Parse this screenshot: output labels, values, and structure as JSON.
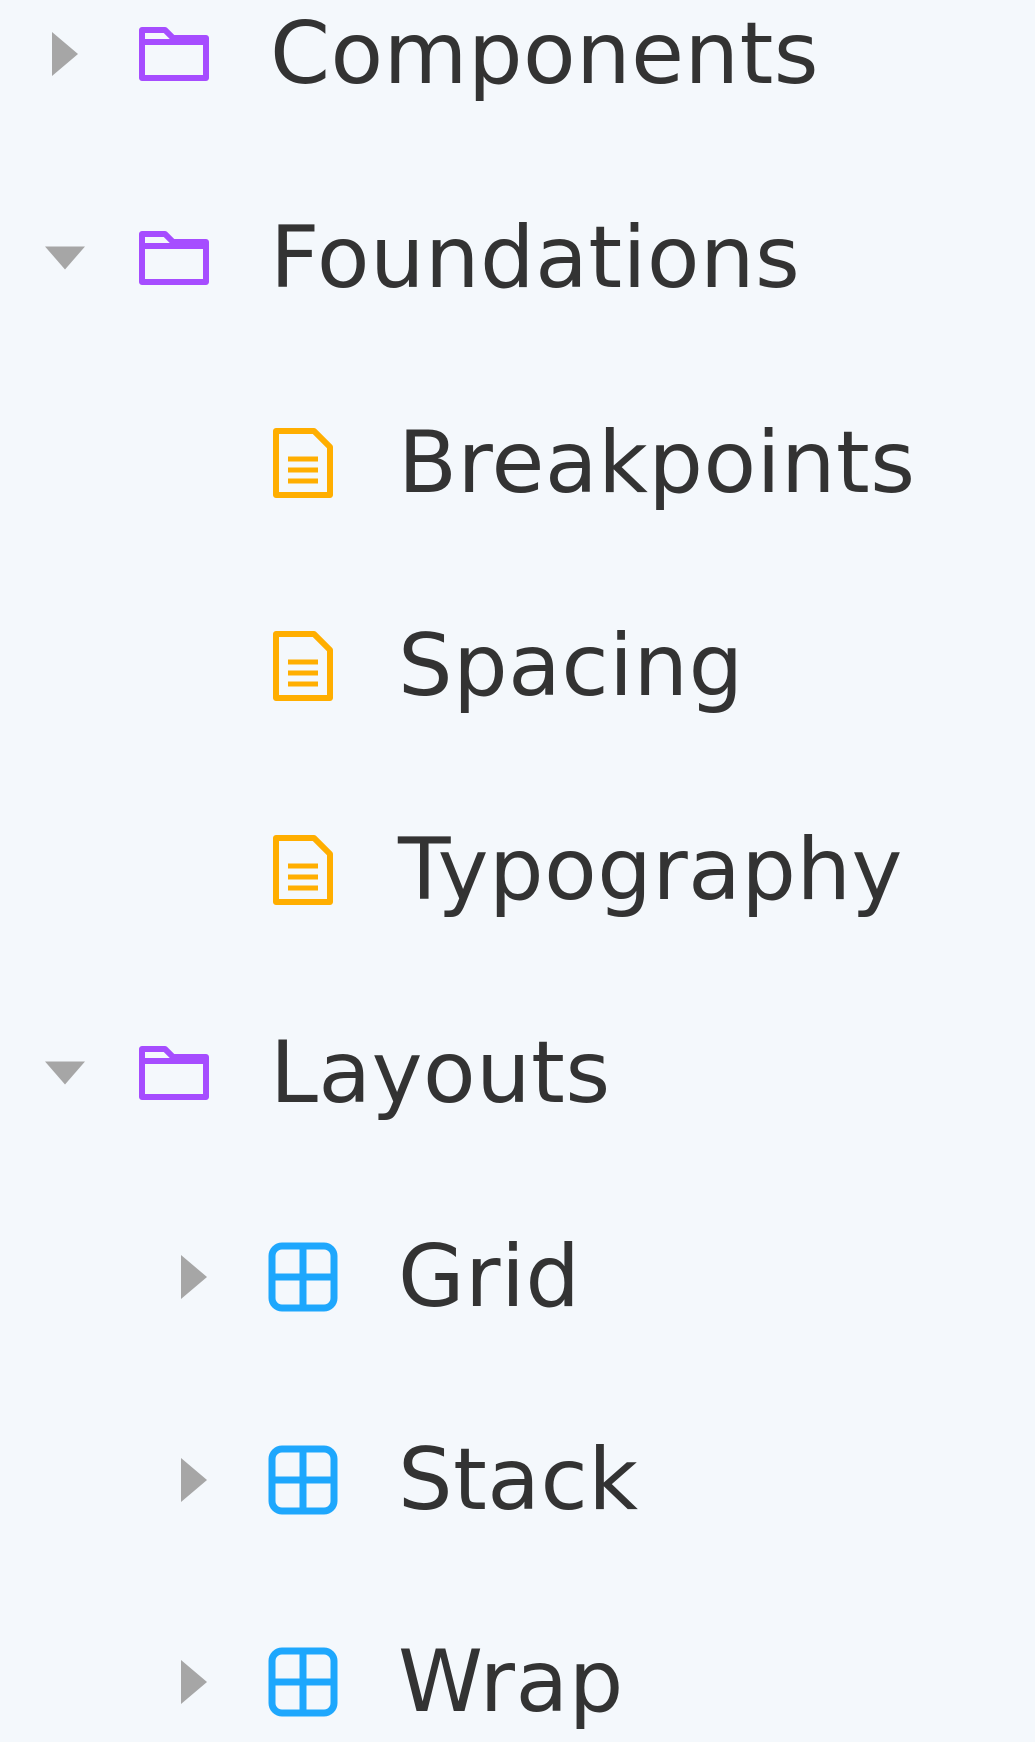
{
  "colors": {
    "background": "#f4f8fc",
    "text": "#333333",
    "caret": "#a6a6a6",
    "folder": "#a64dff",
    "document": "#ffae00",
    "component": "#1ea7fd"
  },
  "tree": {
    "items": [
      {
        "label": "Components",
        "type": "folder",
        "icon": "folder-icon",
        "expanded": false,
        "has_children": true
      },
      {
        "label": "Foundations",
        "type": "folder",
        "icon": "folder-icon",
        "expanded": true,
        "has_children": true
      },
      {
        "label": "Breakpoints",
        "type": "document",
        "icon": "document-icon",
        "has_children": false
      },
      {
        "label": "Spacing",
        "type": "document",
        "icon": "document-icon",
        "has_children": false
      },
      {
        "label": "Typography",
        "type": "document",
        "icon": "document-icon",
        "has_children": false
      },
      {
        "label": "Layouts",
        "type": "folder",
        "icon": "folder-icon",
        "expanded": true,
        "has_children": true
      },
      {
        "label": "Grid",
        "type": "component",
        "icon": "component-grid-icon",
        "expanded": false,
        "has_children": true
      },
      {
        "label": "Stack",
        "type": "component",
        "icon": "component-grid-icon",
        "expanded": false,
        "has_children": true
      },
      {
        "label": "Wrap",
        "type": "component",
        "icon": "component-grid-icon",
        "expanded": false,
        "has_children": true
      }
    ]
  }
}
